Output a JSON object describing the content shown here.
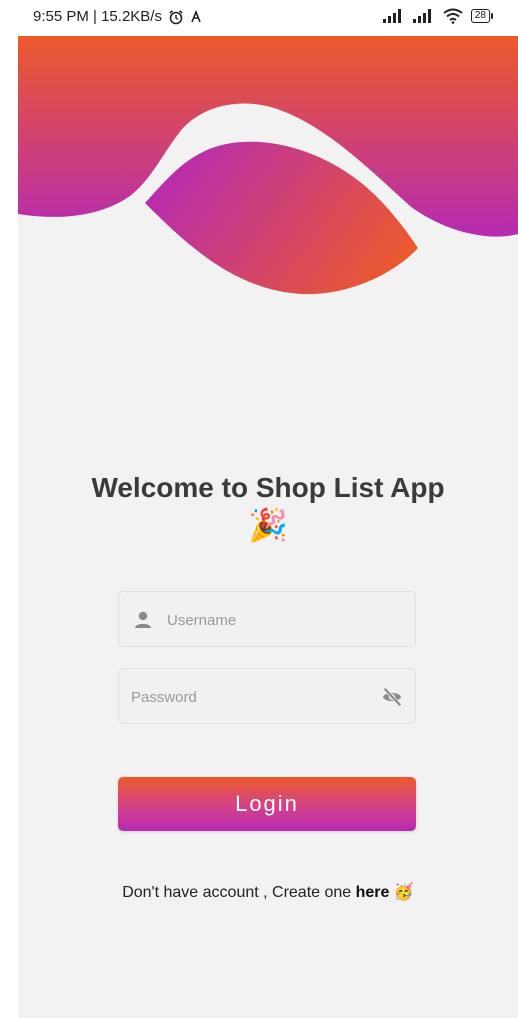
{
  "status_bar": {
    "time_speed": "9:55 PM | 15.2KB/s",
    "battery": "28",
    "icons": [
      "alarm-icon",
      "signal-icon",
      "wifi-icon",
      "battery-icon"
    ]
  },
  "welcome": {
    "title": "Welcome to Shop List App",
    "emoji": "🎉"
  },
  "username": {
    "placeholder": "Username",
    "value": ""
  },
  "password": {
    "placeholder": "Password",
    "value": ""
  },
  "login": {
    "label": "Login"
  },
  "signup": {
    "text": "Don't have account , Create one ",
    "link": "here",
    "emoji": "🥳"
  },
  "colors": {
    "gradient_top": "#ec5a2a",
    "gradient_bottom": "#b72bb0",
    "background": "#f2f2f2"
  }
}
